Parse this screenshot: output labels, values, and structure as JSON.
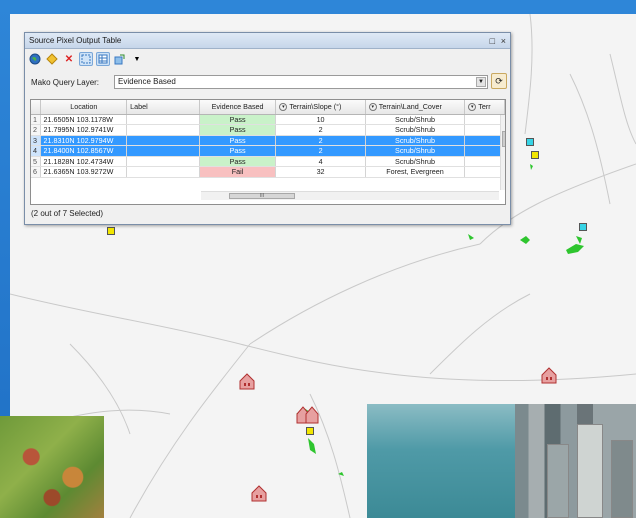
{
  "window": {
    "title": "Source Pixel Output Table",
    "controls": {
      "pin": "□",
      "close": "×"
    }
  },
  "toolbar": {
    "icons": [
      "globe-icon",
      "diamond-icon",
      "delete-icon",
      "select-icon",
      "table-icon",
      "export-icon",
      "dropdown-arrow-icon"
    ]
  },
  "query": {
    "label": "Mako Query Layer:",
    "selected": "Evidence Based"
  },
  "table": {
    "columns": [
      "Location",
      "Label",
      "Evidence Based",
      "Terrain\\Slope (°)",
      "Terrain\\Land_Cover",
      "Terr"
    ],
    "rows": [
      {
        "num": "1",
        "location": "21.6505N 103.1178W",
        "label": "",
        "evidence": "Pass",
        "slope": "10",
        "land_cover": "Scrub/Shrub",
        "selected": false
      },
      {
        "num": "2",
        "location": "21.7995N 102.9741W",
        "label": "",
        "evidence": "Pass",
        "slope": "2",
        "land_cover": "Scrub/Shrub",
        "selected": false
      },
      {
        "num": "3",
        "location": "21.8310N 102.9794W",
        "label": "",
        "evidence": "Pass",
        "slope": "2",
        "land_cover": "Scrub/Shrub",
        "selected": true
      },
      {
        "num": "4",
        "location": "21.8400N 102.8567W",
        "label": "",
        "evidence": "Pass",
        "slope": "2",
        "land_cover": "Scrub/Shrub",
        "selected": true
      },
      {
        "num": "5",
        "location": "21.1828N 102.4734W",
        "label": "",
        "evidence": "Pass",
        "slope": "4",
        "land_cover": "Scrub/Shrub",
        "selected": false
      },
      {
        "num": "6",
        "location": "21.6365N 103.9272W",
        "label": "",
        "evidence": "Fail",
        "slope": "32",
        "land_cover": "Forest, Evergreen",
        "selected": false
      }
    ],
    "hscroll_grip": "III"
  },
  "status": "(2 out of 7 Selected)",
  "colors": {
    "background": "#1f6fc4",
    "selection": "#3399ff",
    "pass": "#c9f2c9",
    "fail": "#f8c0c0"
  }
}
